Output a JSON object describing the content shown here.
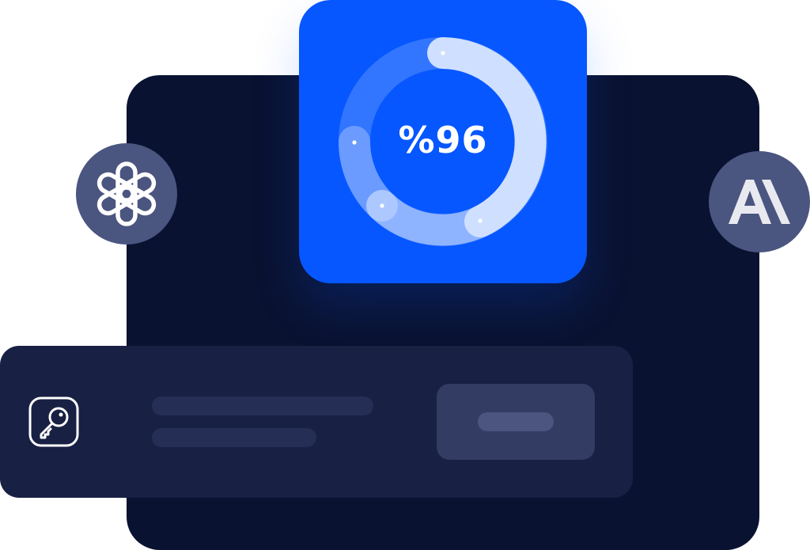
{
  "stat": {
    "label": "%96",
    "progress_percent": 96
  },
  "providers": [
    {
      "name": "openai-logo-icon"
    },
    {
      "name": "anthropic-logo-icon",
      "text": "AI"
    }
  ],
  "key_row": {
    "icon": "key-icon"
  },
  "colors": {
    "background_panel": "#0a1231",
    "card_blue": "#0657ff",
    "badge": "#4a5580",
    "row": "#182043",
    "button": "#333c62"
  }
}
